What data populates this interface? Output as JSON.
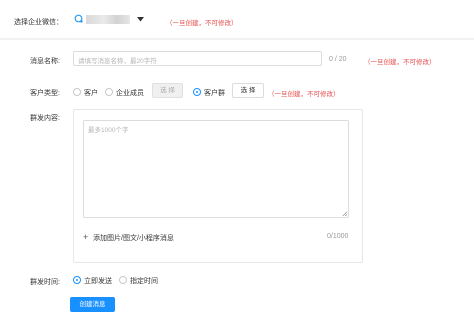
{
  "top": {
    "select_label": "选择企业微信：",
    "note": "（一旦创建，不可修改）",
    "accent": "#1890ff"
  },
  "form": {
    "name": {
      "label": "消息名称:",
      "placeholder": "请填写消息名称，最20字符",
      "counter": "0 / 20",
      "note": "（一旦创建，不可修改）"
    },
    "customer_type": {
      "label": "客户类型:",
      "options": [
        "客户",
        "企业成员",
        "客户群"
      ],
      "selected": "客户群",
      "disabled_select_label": "选 择",
      "select_label": "选 择",
      "note": "（一旦创建，不可修改）"
    },
    "content": {
      "label": "群发内容:",
      "placeholder": "最多1000个字",
      "add_label": "添加图片/图文/小程序消息",
      "counter": "0/1000"
    },
    "send_time": {
      "label": "群发时间:",
      "options": [
        "立即发送",
        "指定时间"
      ],
      "selected": "立即发送"
    },
    "submit_label": "创建消息"
  }
}
